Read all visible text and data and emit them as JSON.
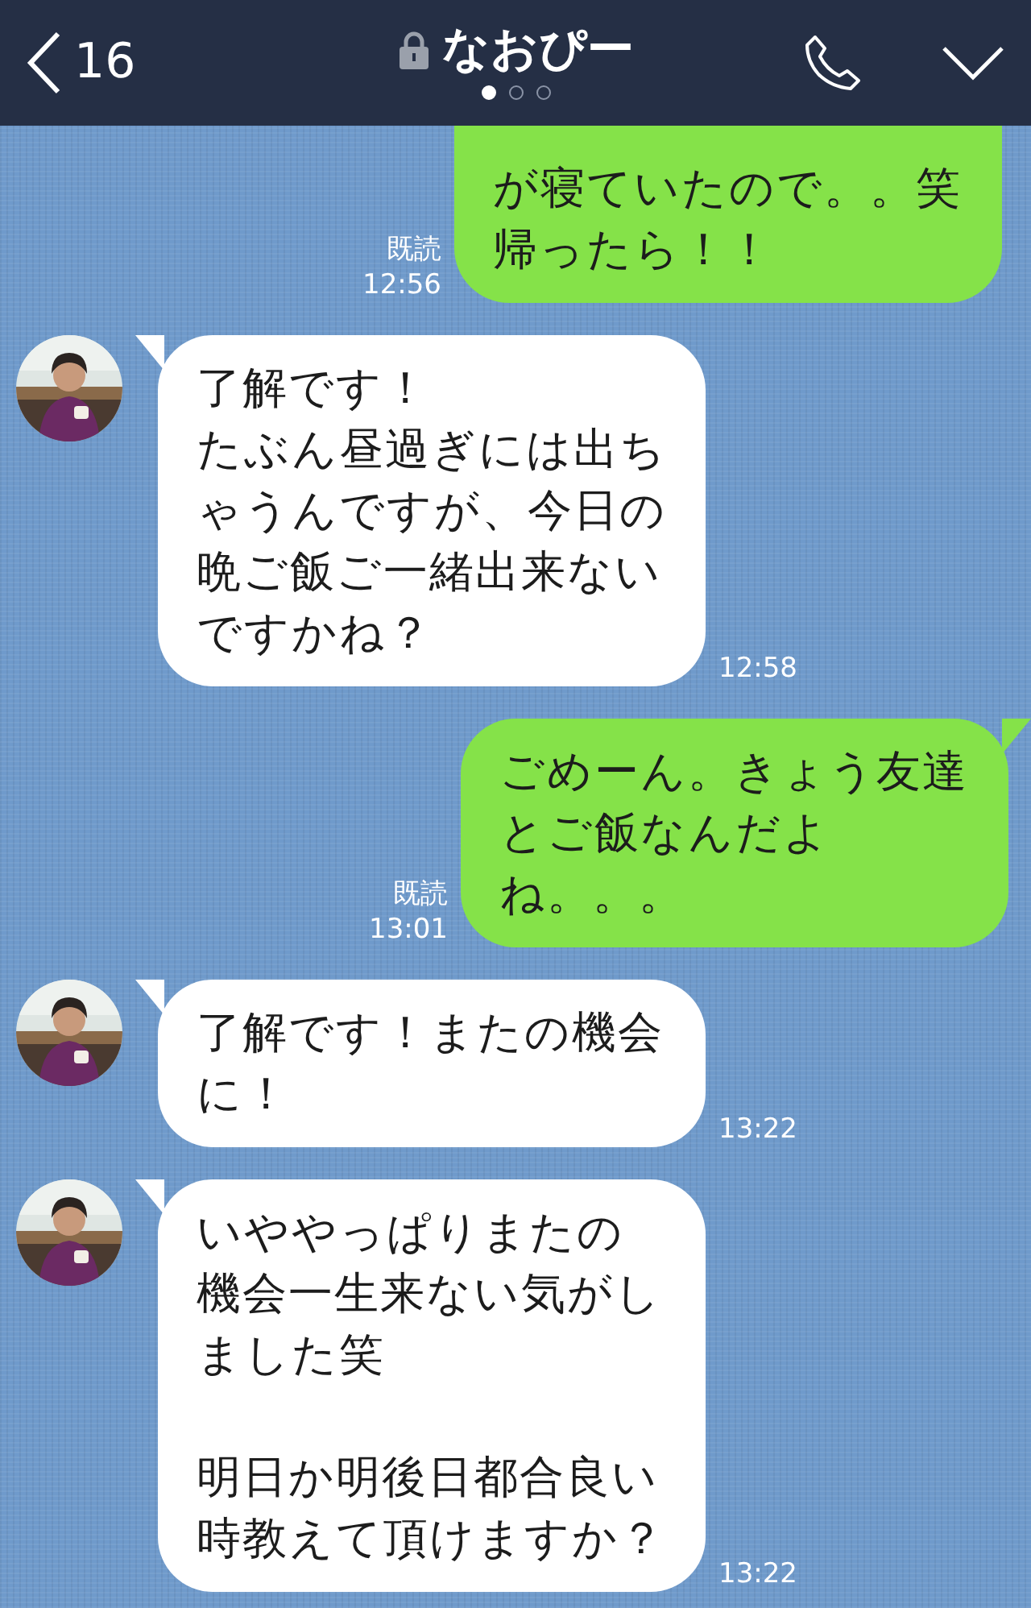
{
  "header": {
    "back_count": "16",
    "title": "なおぴー",
    "pages": [
      {
        "selected": true
      },
      {
        "selected": false
      },
      {
        "selected": false
      }
    ]
  },
  "messages": [
    {
      "kind": "sent",
      "paragraphs": [
        "が寝ていたので。。笑",
        "帰ったら！！"
      ],
      "read": "既読",
      "time": "12:56",
      "clipped": true
    },
    {
      "kind": "received",
      "paragraphs": [
        "了解です！",
        "たぶん昼過ぎには出ちゃうんですが、今日の晩ご飯ご一緒出来ないですかね？"
      ],
      "time": "12:58",
      "avatar": {
        "kind": "picture"
      }
    },
    {
      "kind": "sent",
      "paragraphs": [
        "ごめーん。きょう友達とご飯なんだよね。。。"
      ],
      "read": "既読",
      "time": "13:01"
    },
    {
      "kind": "received",
      "paragraphs": [
        "了解です！またの機会に！"
      ],
      "time": "13:22",
      "avatar": {
        "kind": "picture"
      }
    },
    {
      "kind": "received",
      "paragraphs": [
        "いややっぱりまたの機会一生来ない気がしました笑",
        "明日か明後日都合良い時教えて頂けますか？"
      ],
      "time": "13:22",
      "avatar": {
        "kind": "picture"
      }
    }
  ]
}
